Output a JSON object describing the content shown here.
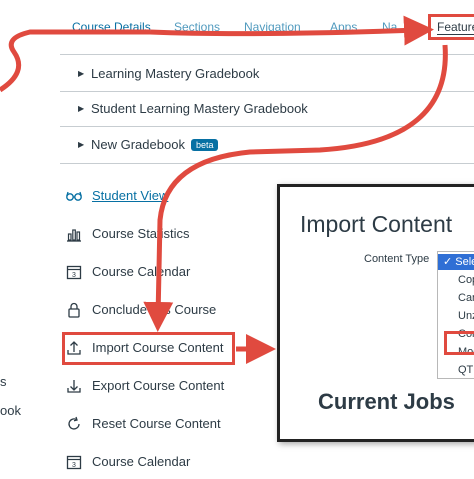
{
  "tabs": [
    {
      "label": "Course Details"
    },
    {
      "label": "Sections"
    },
    {
      "label": "Navigation"
    },
    {
      "label": "Apps"
    },
    {
      "label": "Na"
    }
  ],
  "feature_tab": {
    "label": "Feature Options"
  },
  "feature_options": [
    {
      "label": "Learning Mastery Gradebook"
    },
    {
      "label": "Student Learning Mastery Gradebook"
    },
    {
      "label": "New Gradebook",
      "badge": "beta"
    }
  ],
  "sidebar": {
    "items": [
      {
        "label": "Student View",
        "icon": "glasses-icon"
      },
      {
        "label": "Course Statistics",
        "icon": "bar-chart-icon"
      },
      {
        "label": "Course Calendar",
        "icon": "calendar-icon"
      },
      {
        "label": "Conclude this Course",
        "icon": "lock-icon"
      },
      {
        "label": "Import Course Content",
        "icon": "upload-icon"
      },
      {
        "label": "Export Course Content",
        "icon": "download-icon"
      },
      {
        "label": "Reset Course Content",
        "icon": "reset-icon"
      },
      {
        "label": "Course Calendar",
        "icon": "calendar-icon"
      }
    ]
  },
  "left_fragments": [
    "s",
    "ook"
  ],
  "import_panel": {
    "title": "Import Content",
    "content_type_label": "Content Type",
    "dropdown_options": [
      "✓ Sele",
      "Cop",
      "Can",
      "Unz",
      "Com",
      "Moo",
      "QTI"
    ],
    "selected_index": 0,
    "highlighted_index": 5,
    "current_jobs_title": "Current Jobs"
  },
  "colors": {
    "accent": "#e04a3f",
    "link": "#0770a3",
    "selected": "#2f6fd5",
    "text": "#2d3b45"
  }
}
